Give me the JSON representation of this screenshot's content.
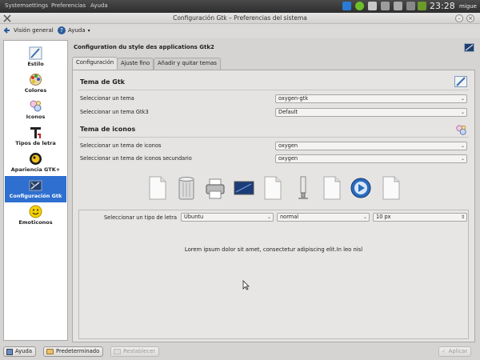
{
  "panel_top": {
    "menus": [
      "Systemsettings",
      "Preferencias",
      "Ayuda"
    ],
    "clock": "23:28",
    "user": "migue"
  },
  "window": {
    "title": "Configuración Gtk – Preferencias del sistema"
  },
  "toolbar": {
    "overview_label": "Visión general",
    "help_label": "Ayuda"
  },
  "sidebar": {
    "items": [
      {
        "label": "Estilo",
        "icon": "brush-icon"
      },
      {
        "label": "Colores",
        "icon": "palette-icon"
      },
      {
        "label": "Iconos",
        "icon": "icons-icon"
      },
      {
        "label": "Tipos de letra",
        "icon": "font-icon"
      },
      {
        "label": "Apariencia GTK+",
        "icon": "gimp-icon"
      },
      {
        "label": "Configuración Gtk",
        "icon": "gtk-config-icon"
      },
      {
        "label": "Emoticonos",
        "icon": "smiley-icon"
      }
    ],
    "selected": "Configuración Gtk"
  },
  "content": {
    "heading": "Configuration du style des applications Gtk2",
    "tabs": [
      "Configuración",
      "Ajuste fino",
      "Añadir y quitar temas"
    ],
    "active_tab": "Configuración",
    "gtk_theme": {
      "title": "Tema de Gtk",
      "rows": [
        {
          "label": "Seleccionar un tema",
          "value": "oxygen-gtk"
        },
        {
          "label": "Seleccionar un tema Gtk3",
          "value": "Default"
        }
      ]
    },
    "icon_theme": {
      "title": "Tema de iconos",
      "rows": [
        {
          "label": "Seleccionar un tema de iconos",
          "value": "oxygen"
        },
        {
          "label": "Seleccionar un tema de iconos secundario",
          "value": "oxygen"
        }
      ]
    },
    "preview_icons": [
      "document-icon",
      "trash-icon",
      "printer-icon",
      "monitor-icon",
      "document-icon",
      "usb-drive-icon",
      "document-icon",
      "media-player-icon",
      "document-icon"
    ],
    "font": {
      "label": "Seleccionar un tipo de letra",
      "family": "Ubuntu",
      "style": "normal",
      "size": "10 px"
    },
    "preview_text": "Lorem ipsum dolor sit amet, consectetur adipiscing elit.In leo nisl"
  },
  "bottom": {
    "help_label": "Ayuda",
    "defaults_label": "Predeterminado",
    "reset_label": "Restablecer",
    "apply_label": "Aplicar"
  }
}
